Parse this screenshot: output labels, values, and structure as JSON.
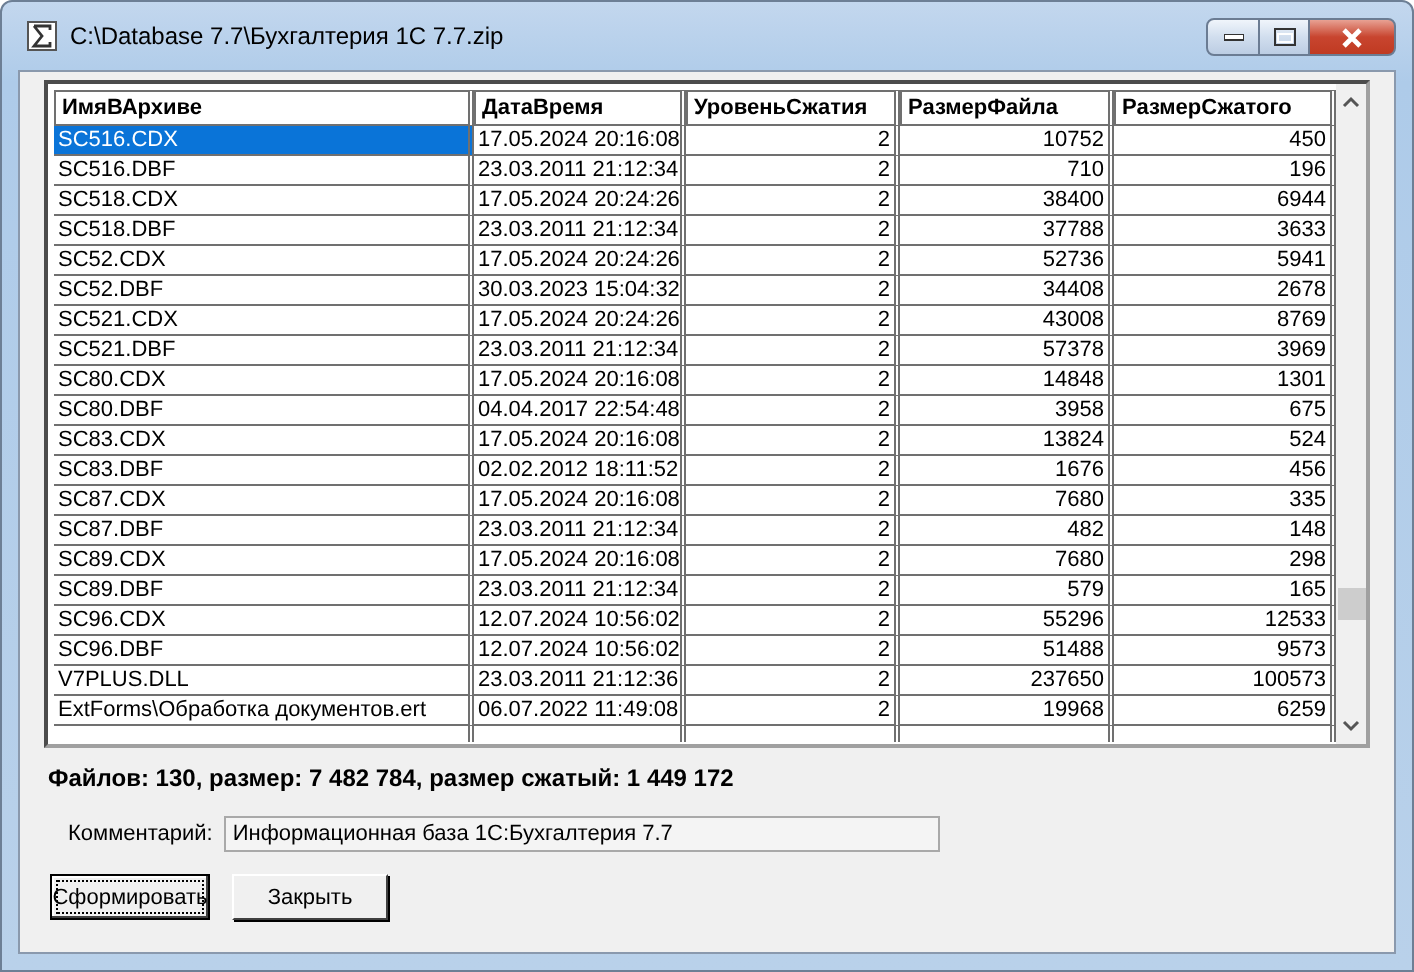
{
  "window": {
    "title": "C:\\Database 7.7\\Бухгалтерия 1С 7.7.zip"
  },
  "table": {
    "columns": [
      "ИмяВАрхиве",
      "ДатаВремя",
      "УровеньСжатия",
      "РазмерФайла",
      "РазмерСжатого"
    ],
    "rows": [
      {
        "selected": true,
        "cells": [
          "SC516.CDX",
          "17.05.2024 20:16:08",
          "2",
          "10752",
          "450"
        ]
      },
      {
        "selected": false,
        "cells": [
          "SC516.DBF",
          "23.03.2011 21:12:34",
          "2",
          "710",
          "196"
        ]
      },
      {
        "selected": false,
        "cells": [
          "SC518.CDX",
          "17.05.2024 20:24:26",
          "2",
          "38400",
          "6944"
        ]
      },
      {
        "selected": false,
        "cells": [
          "SC518.DBF",
          "23.03.2011 21:12:34",
          "2",
          "37788",
          "3633"
        ]
      },
      {
        "selected": false,
        "cells": [
          "SC52.CDX",
          "17.05.2024 20:24:26",
          "2",
          "52736",
          "5941"
        ]
      },
      {
        "selected": false,
        "cells": [
          "SC52.DBF",
          "30.03.2023 15:04:32",
          "2",
          "34408",
          "2678"
        ]
      },
      {
        "selected": false,
        "cells": [
          "SC521.CDX",
          "17.05.2024 20:24:26",
          "2",
          "43008",
          "8769"
        ]
      },
      {
        "selected": false,
        "cells": [
          "SC521.DBF",
          "23.03.2011 21:12:34",
          "2",
          "57378",
          "3969"
        ]
      },
      {
        "selected": false,
        "cells": [
          "SC80.CDX",
          "17.05.2024 20:16:08",
          "2",
          "14848",
          "1301"
        ]
      },
      {
        "selected": false,
        "cells": [
          "SC80.DBF",
          "04.04.2017 22:54:48",
          "2",
          "3958",
          "675"
        ]
      },
      {
        "selected": false,
        "cells": [
          "SC83.CDX",
          "17.05.2024 20:16:08",
          "2",
          "13824",
          "524"
        ]
      },
      {
        "selected": false,
        "cells": [
          "SC83.DBF",
          "02.02.2012 18:11:52",
          "2",
          "1676",
          "456"
        ]
      },
      {
        "selected": false,
        "cells": [
          "SC87.CDX",
          "17.05.2024 20:16:08",
          "2",
          "7680",
          "335"
        ]
      },
      {
        "selected": false,
        "cells": [
          "SC87.DBF",
          "23.03.2011 21:12:34",
          "2",
          "482",
          "148"
        ]
      },
      {
        "selected": false,
        "cells": [
          "SC89.CDX",
          "17.05.2024 20:16:08",
          "2",
          "7680",
          "298"
        ]
      },
      {
        "selected": false,
        "cells": [
          "SC89.DBF",
          "23.03.2011 21:12:34",
          "2",
          "579",
          "165"
        ]
      },
      {
        "selected": false,
        "cells": [
          "SC96.CDX",
          "12.07.2024 10:56:02",
          "2",
          "55296",
          "12533"
        ]
      },
      {
        "selected": false,
        "cells": [
          "SC96.DBF",
          "12.07.2024 10:56:02",
          "2",
          "51488",
          "9573"
        ]
      },
      {
        "selected": false,
        "cells": [
          "V7PLUS.DLL",
          "23.03.2011 21:12:36",
          "2",
          "237650",
          "100573"
        ]
      },
      {
        "selected": false,
        "cells": [
          "ExtForms\\Обработка документов.ert",
          "06.07.2022 11:49:08",
          "2",
          "19968",
          "6259"
        ]
      }
    ]
  },
  "summary": "Файлов: 130, размер: 7 482 784, размер сжатый: 1 449 172",
  "comment": {
    "label": "Комментарий:",
    "value": "Информационная база 1С:Бухгалтерия 7.7"
  },
  "buttons": [
    {
      "label": "Сформировать",
      "focused": true
    },
    {
      "label": "Закрыть",
      "focused": false
    }
  ]
}
